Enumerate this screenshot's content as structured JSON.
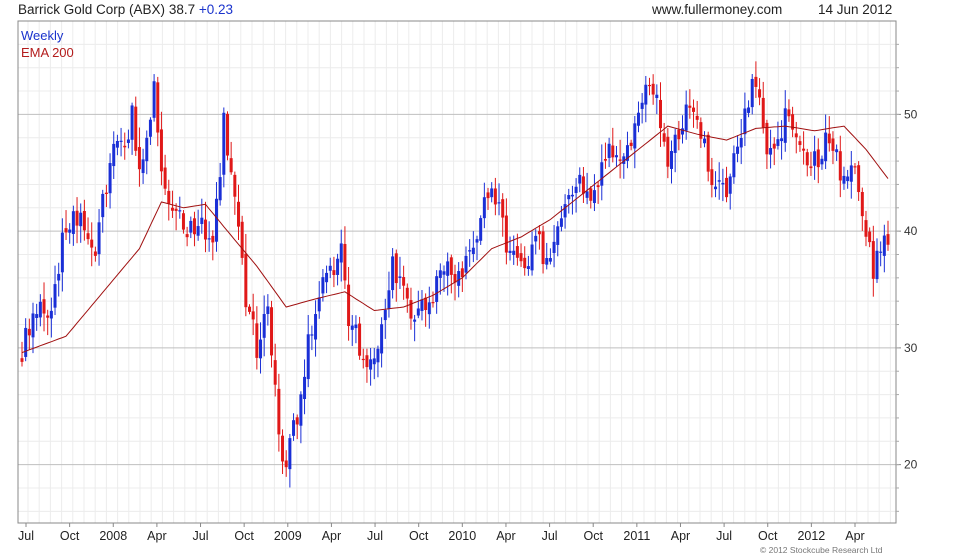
{
  "header": {
    "instrument": "Barrick Gold Corp (ABX)",
    "price": "38.7",
    "change": "+0.23",
    "website": "www.fullermoney.com",
    "date": "14 Jun 2012"
  },
  "legend": {
    "weekly": "Weekly",
    "ema": "EMA 200"
  },
  "footer": {
    "copyright": "© 2012 Stockcube Research Ltd"
  },
  "colors": {
    "up": "#1a2fd6",
    "down": "#e01818",
    "ema": "#a01010",
    "grid": "#cfcfcf",
    "frame": "#888888"
  },
  "chart_data": {
    "type": "candlestick",
    "ylim": [
      15,
      58
    ],
    "yticks": [
      20,
      30,
      40,
      50
    ],
    "xticks": [
      "Jul",
      "Oct",
      "2008",
      "Apr",
      "Jul",
      "Oct",
      "2009",
      "Apr",
      "Jul",
      "Oct",
      "2010",
      "Apr",
      "Jul",
      "Oct",
      "2011",
      "Apr",
      "Jul",
      "Oct",
      "2012",
      "Apr"
    ],
    "weekly_close_anchors": [
      [
        0,
        30
      ],
      [
        4,
        34
      ],
      [
        7,
        32
      ],
      [
        9,
        35
      ],
      [
        11,
        39
      ],
      [
        14,
        42
      ],
      [
        17,
        40
      ],
      [
        20,
        38
      ],
      [
        23,
        44
      ],
      [
        26,
        48
      ],
      [
        28,
        46
      ],
      [
        30,
        50
      ],
      [
        32,
        45
      ],
      [
        34,
        48
      ],
      [
        36,
        52
      ],
      [
        38,
        46
      ],
      [
        40,
        43
      ],
      [
        43,
        41
      ],
      [
        46,
        40
      ],
      [
        49,
        41
      ],
      [
        52,
        38
      ],
      [
        55,
        49
      ],
      [
        58,
        42
      ],
      [
        61,
        34
      ],
      [
        64,
        30
      ],
      [
        67,
        33
      ],
      [
        70,
        22
      ],
      [
        72,
        20
      ],
      [
        75,
        24
      ],
      [
        78,
        30
      ],
      [
        81,
        35
      ],
      [
        84,
        37
      ],
      [
        87,
        38
      ],
      [
        89,
        33
      ],
      [
        92,
        30
      ],
      [
        95,
        28
      ],
      [
        98,
        31
      ],
      [
        101,
        37
      ],
      [
        104,
        35
      ],
      [
        107,
        33
      ],
      [
        110,
        34
      ],
      [
        113,
        35
      ],
      [
        116,
        38
      ],
      [
        119,
        36
      ],
      [
        122,
        39
      ],
      [
        125,
        41
      ],
      [
        128,
        44
      ],
      [
        131,
        40
      ],
      [
        134,
        38
      ],
      [
        137,
        36
      ],
      [
        140,
        39
      ],
      [
        143,
        38
      ],
      [
        146,
        40
      ],
      [
        149,
        43
      ],
      [
        152,
        44
      ],
      [
        155,
        42
      ],
      [
        158,
        45
      ],
      [
        161,
        47
      ],
      [
        164,
        46
      ],
      [
        167,
        49
      ],
      [
        170,
        53
      ],
      [
        173,
        51
      ],
      [
        176,
        46
      ],
      [
        179,
        48
      ],
      [
        182,
        51
      ],
      [
        185,
        49
      ],
      [
        188,
        44
      ],
      [
        191,
        43
      ],
      [
        194,
        46
      ],
      [
        197,
        50
      ],
      [
        200,
        53
      ],
      [
        203,
        46
      ],
      [
        206,
        48
      ],
      [
        209,
        51
      ],
      [
        212,
        47
      ],
      [
        215,
        45
      ],
      [
        218,
        47
      ],
      [
        221,
        48
      ],
      [
        224,
        44
      ],
      [
        227,
        46
      ],
      [
        229,
        41
      ],
      [
        232,
        37
      ],
      [
        234,
        39
      ],
      [
        236,
        38.7
      ]
    ],
    "ema200_anchors": [
      [
        0,
        29.6
      ],
      [
        12,
        31
      ],
      [
        24,
        35.5
      ],
      [
        32,
        38.5
      ],
      [
        38,
        42.5
      ],
      [
        44,
        42
      ],
      [
        50,
        42.3
      ],
      [
        56,
        40
      ],
      [
        64,
        37
      ],
      [
        72,
        33.5
      ],
      [
        80,
        34.2
      ],
      [
        88,
        34.8
      ],
      [
        96,
        33.2
      ],
      [
        104,
        33.5
      ],
      [
        112,
        34.5
      ],
      [
        120,
        36
      ],
      [
        128,
        38.5
      ],
      [
        136,
        39.5
      ],
      [
        144,
        41
      ],
      [
        152,
        43
      ],
      [
        160,
        45
      ],
      [
        168,
        47
      ],
      [
        176,
        49
      ],
      [
        184,
        48.3
      ],
      [
        192,
        47.8
      ],
      [
        200,
        48.8
      ],
      [
        208,
        49
      ],
      [
        216,
        48.6
      ],
      [
        224,
        49
      ],
      [
        230,
        47
      ],
      [
        236,
        44.5
      ]
    ]
  }
}
